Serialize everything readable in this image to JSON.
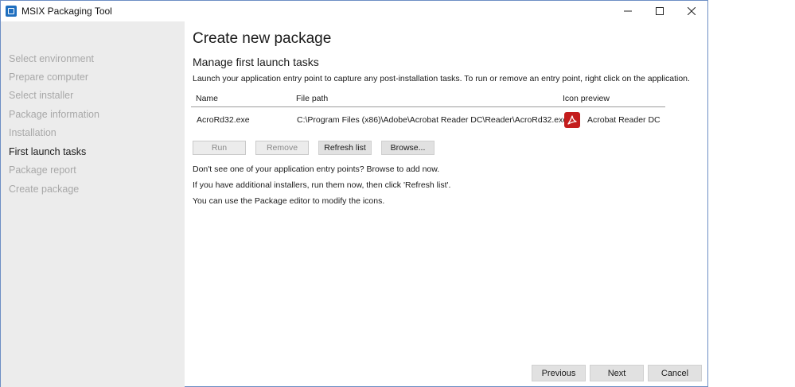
{
  "window": {
    "title": "MSIX Packaging Tool",
    "controls": {
      "minimize": "—",
      "maximize": "☐",
      "close": "✕"
    }
  },
  "sidebar": {
    "items": [
      {
        "label": "Select environment",
        "active": false
      },
      {
        "label": "Prepare computer",
        "active": false
      },
      {
        "label": "Select installer",
        "active": false
      },
      {
        "label": "Package information",
        "active": false
      },
      {
        "label": "Installation",
        "active": false
      },
      {
        "label": "First launch tasks",
        "active": true
      },
      {
        "label": "Package report",
        "active": false
      },
      {
        "label": "Create package",
        "active": false
      }
    ]
  },
  "main": {
    "title": "Create new package",
    "section_title": "Manage first launch tasks",
    "description": "Launch your application entry point to capture any post-installation tasks. To run or remove an entry point, right click on the application.",
    "table": {
      "headers": {
        "name": "Name",
        "file_path": "File path",
        "icon_preview": "Icon preview"
      },
      "rows": [
        {
          "name": "AcroRd32.exe",
          "file_path": "C:\\Program Files (x86)\\Adobe\\Acrobat Reader DC\\Reader\\AcroRd32.exe",
          "icon_name": "acrobat-pdf-icon",
          "icon_label": "Acrobat Reader DC"
        }
      ]
    },
    "actions": {
      "run": "Run",
      "remove": "Remove",
      "refresh": "Refresh list",
      "browse": "Browse..."
    },
    "hints": [
      "Don't see one of your application entry points? Browse to add now.",
      "If you have additional installers, run them now, then click 'Refresh list'.",
      "You can use the Package editor to modify the icons."
    ]
  },
  "footer": {
    "previous": "Previous",
    "next": "Next",
    "cancel": "Cancel"
  },
  "colors": {
    "sidebar_bg": "#ececec",
    "active_item": "#1a1a1a",
    "inactive_item": "#a8a8a8",
    "pdf_red": "#c41d1d"
  }
}
